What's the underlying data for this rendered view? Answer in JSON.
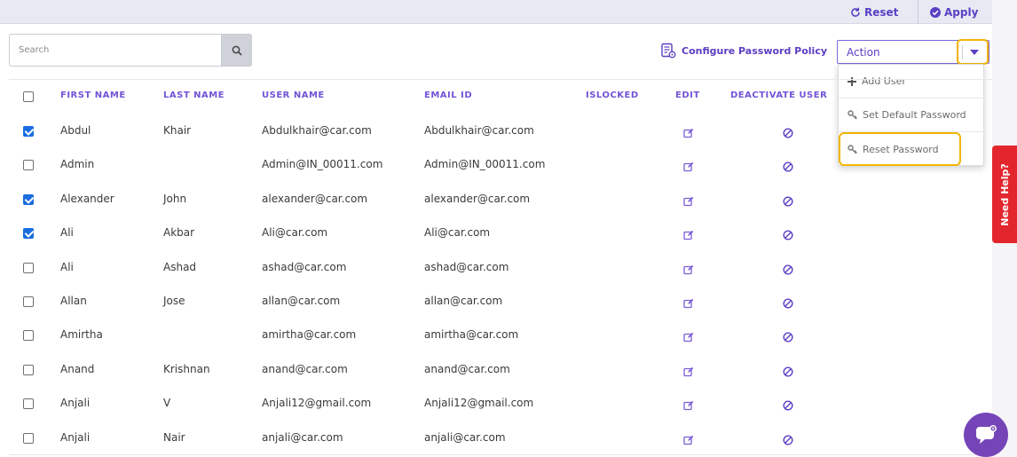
{
  "toolbar": {
    "reset_label": "Reset",
    "apply_label": "Apply"
  },
  "search": {
    "placeholder": "Search",
    "value": ""
  },
  "configure_policy_label": "Configure Password Policy",
  "action": {
    "selected": "Action",
    "menu": [
      {
        "label": "Add User",
        "icon": "plus-icon"
      },
      {
        "label": "Set Default Password",
        "icon": "key-icon"
      },
      {
        "label": "Reset Password",
        "icon": "key-icon"
      }
    ]
  },
  "table": {
    "headers": {
      "first_name": "FIRST NAME",
      "last_name": "LAST NAME",
      "user_name": "USER NAME",
      "email_id": "EMAIL ID",
      "islocked": "ISLOCKED",
      "edit": "EDIT",
      "deactivate_user": "DEACTIVATE USER"
    },
    "rows": [
      {
        "checked": true,
        "first": "Abdul",
        "last": "Khair",
        "user": "Abdulkhair@car.com",
        "email": "Abdulkhair@car.com"
      },
      {
        "checked": false,
        "first": "Admin",
        "last": "",
        "user": "Admin@IN_00011.com",
        "email": "Admin@IN_00011.com"
      },
      {
        "checked": true,
        "first": "Alexander",
        "last": "John",
        "user": "alexander@car.com",
        "email": "alexander@car.com"
      },
      {
        "checked": true,
        "first": "Ali",
        "last": "Akbar",
        "user": "Ali@car.com",
        "email": "Ali@car.com"
      },
      {
        "checked": false,
        "first": "Ali",
        "last": "Ashad",
        "user": "ashad@car.com",
        "email": "ashad@car.com"
      },
      {
        "checked": false,
        "first": "Allan",
        "last": "Jose",
        "user": "allan@car.com",
        "email": "allan@car.com"
      },
      {
        "checked": false,
        "first": "Amirtha",
        "last": "",
        "user": "amirtha@car.com",
        "email": "amirtha@car.com"
      },
      {
        "checked": false,
        "first": "Anand",
        "last": "Krishnan",
        "user": "anand@car.com",
        "email": "anand@car.com"
      },
      {
        "checked": false,
        "first": "Anjali",
        "last": "V",
        "user": "Anjali12@gmail.com",
        "email": "Anjali12@gmail.com"
      },
      {
        "checked": false,
        "first": "Anjali",
        "last": "Nair",
        "user": "anjali@car.com",
        "email": "anjali@car.com"
      }
    ]
  },
  "help_tab_label": "Need Help?",
  "colors": {
    "accent": "#5b3fc4",
    "highlight": "#f2b500",
    "checkbox_checked": "#1a6dde",
    "help_tab": "#e3262e",
    "chat_bubble": "#7545b8"
  }
}
